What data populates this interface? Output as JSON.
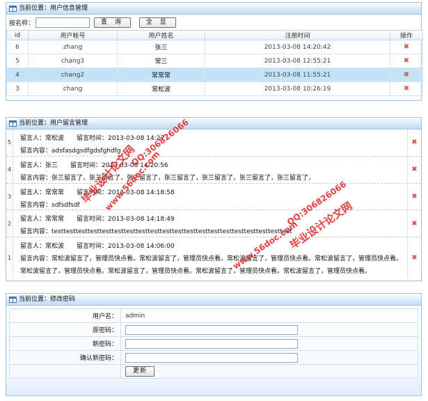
{
  "user_panel": {
    "title": "当前位置：用户信息管理",
    "search_label": "按名称：",
    "search_value": "",
    "query_button": "查 询",
    "show_all_button": "全 显",
    "columns": [
      "id",
      "用户帐号",
      "用户姓名",
      "注册时间",
      "操作"
    ],
    "rows": [
      {
        "id": "6",
        "account": "zhang",
        "name": "张三",
        "time": "2013-03-08 14:20:42",
        "highlight": false
      },
      {
        "id": "5",
        "account": "chang3",
        "name": "常三",
        "time": "2013-03-08 12:55:21",
        "highlight": false
      },
      {
        "id": "4",
        "account": "chang2",
        "name": "常常常",
        "time": "2013-03-08 11:55:21",
        "highlight": true
      },
      {
        "id": "3",
        "account": "chang",
        "name": "常松波",
        "time": "2013-03-08 10:26:19",
        "highlight": false
      }
    ],
    "delete_icon": "✖"
  },
  "message_panel": {
    "title": "当前位置：用户留言管理",
    "messages": [
      {
        "num": "5",
        "line1": "留言人：常松波　　留言时间：2013-03-08 14:27",
        "line2": "留言内容：adsfasdgsdfgdsfghdfg"
      },
      {
        "num": "4",
        "line1": "留言人：张三　　留言时间：2013-03-08 14:20:56",
        "line2": "留言内容：张三留言了，张三留言了，张三留言了，张三留言了，张三留言了，张三留言了，张三留言了，"
      },
      {
        "num": "3",
        "line1": "留言人：常常常　　留言时间：2013-03-08 14:18:58",
        "line2": "留言内容：sdfsdfsdf"
      },
      {
        "num": "2",
        "line1": "留言人：常常常　　留言时间：2013-03-08 14:18:49",
        "line2": "留言内容：testtesttesttesttesttesttesttesttesttesttesttesttesttesttesttesttesttesttesttest"
      },
      {
        "num": "1",
        "line1": "留言人：常松波　　留言时间：2013-03-08 14:06:00",
        "line2": "留言内容：常松波留言了，管理员快点看。常松波留言了，管理员快点看。常松波留言了，管理员快点看。常松波留言了，管理员快点看。常松波留言了，管理员快点看。常松波留言了，管理员快点看。常松波留言了，管理员快点看。常松波留言了，管理员快点看。"
      }
    ],
    "delete_icon": "✖"
  },
  "password_panel": {
    "title": "当前位置：修改密码",
    "username_label": "用户名：",
    "username_value": "admin",
    "old_label": "原密码：",
    "new_label": "新密码：",
    "confirm_label": "确认新密码：",
    "update_button": "更新"
  },
  "watermark": {
    "line_a": "毕业设计论文网",
    "line_b": "www.56doc.com",
    "line_c": "QQ:306826066",
    "color": "#e0201f"
  }
}
